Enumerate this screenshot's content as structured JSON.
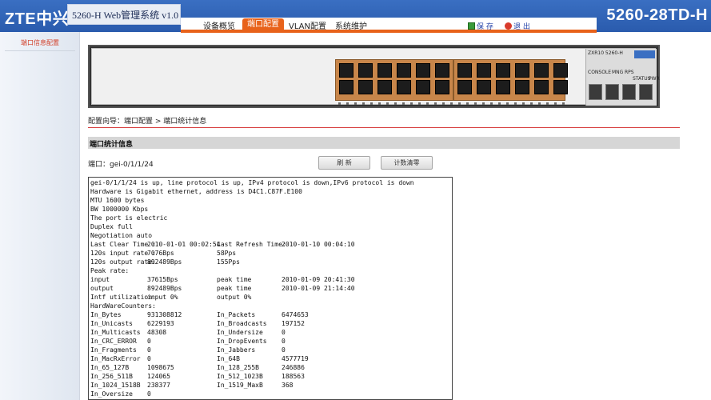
{
  "header": {
    "logo": "ZTE中兴",
    "system_title": "5260-H Web管理系统 v1.0",
    "model": "5260-28TD-H",
    "nav": [
      "设备概览",
      "端口配置",
      "VLAN配置",
      "系统维护"
    ],
    "active_nav": "端口配置",
    "save_label": "保 存",
    "exit_label": "退 出"
  },
  "sidebar": {
    "items": [
      "端口信息配置"
    ]
  },
  "device": {
    "brand_text": "ZXR10 5260-H",
    "port_labels": [
      "CONSOLE",
      "MNG",
      "RPS",
      "STATUS",
      "PWR"
    ]
  },
  "breadcrumb": "配置向导：端口配置 > 端口统计信息",
  "section_title": "端口统计信息",
  "port_label": "端口：gei-0/1/1/24",
  "buttons": {
    "refresh": "刷 新",
    "clear": "计数清零"
  },
  "stats_lines": [
    "gei-0/1/1/24 is up, line protocol is up, IPv4 protocol is down,IPv6 protocol is down",
    "Hardware is Gigabit ethernet, address is D4C1.C87F.E100",
    "MTU 1600 bytes",
    "BW 1000000 Kbps",
    "The port is electric",
    "Duplex full",
    "Negotiation auto"
  ],
  "stats_kv": [
    [
      "Last Clear Time :",
      "2010-01-01 00:02:54",
      "Last Refresh Time:",
      "2010-01-10 00:04:10"
    ],
    [
      "120s input rate :",
      "7076Bps",
      "58Pps",
      ""
    ],
    [
      "120s output rate:",
      "892489Bps",
      "155Pps",
      ""
    ],
    [
      "Peak rate:",
      "",
      "",
      ""
    ],
    [
      "input",
      "37615Bps",
      "peak time",
      "2010-01-09 20:41:30"
    ],
    [
      "output",
      "892489Bps",
      "peak time",
      "2010-01-09 21:14:40"
    ],
    [
      "Intf utilization:",
      "input 0%",
      "output 0%",
      ""
    ],
    [
      "HardWareCounters:",
      "",
      "",
      ""
    ],
    [
      "In_Bytes",
      "931308812",
      "In_Packets",
      "6474653"
    ],
    [
      "In_Unicasts",
      "6229193",
      "In_Broadcasts",
      "197152"
    ],
    [
      "In_Multicasts",
      "48308",
      "In_Undersize",
      "0"
    ],
    [
      "In_CRC_ERROR",
      "0",
      "In_DropEvents",
      "0"
    ],
    [
      "In_Fragments",
      "0",
      "In_Jabbers",
      "0"
    ],
    [
      "In_MacRxError",
      "0",
      "In_64B",
      "4577719"
    ],
    [
      "In_65_127B",
      "1098675",
      "In_128_255B",
      "246886"
    ],
    [
      "In_256_511B",
      "124065",
      "In_512_1023B",
      "188563"
    ],
    [
      "In_1024_1518B",
      "238377",
      "In_1519_MaxB",
      "368"
    ],
    [
      "In_Oversize",
      "0",
      "",
      ""
    ]
  ],
  "colors": {
    "header_blue": "#2a5bad",
    "accent_orange": "#e8621a",
    "rule_red": "#d84040",
    "link_blue": "#2342a8"
  },
  "icons": {
    "save": "save-icon",
    "exit": "exit-icon"
  }
}
